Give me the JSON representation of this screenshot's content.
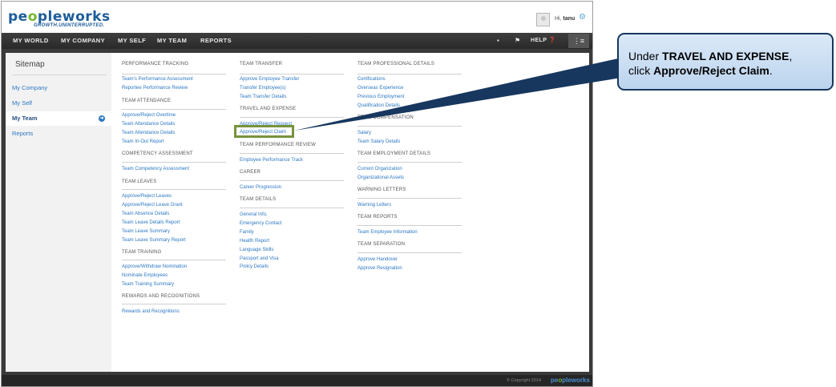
{
  "header": {
    "logo_pre": "pe",
    "logo_o": "o",
    "logo_post": "pleworks",
    "tagline": "GROWTH.UNINTERRUPTED.",
    "greeting_prefix": "Hi,",
    "user": "tanu"
  },
  "nav": {
    "items": [
      "MY WORLD",
      "MY COMPANY",
      "MY SELF",
      "MY TEAM",
      "REPORTS"
    ],
    "help_label": "HELP"
  },
  "sidebar": {
    "title": "Sitemap",
    "items": [
      "My Company",
      "My Self",
      "My Team",
      "Reports"
    ]
  },
  "columns": {
    "col1": {
      "performance_tracking": {
        "title": "PERFORMANCE TRACKING",
        "links": [
          "Team's Performance Assessment",
          "Reportee Performance Review"
        ]
      },
      "team_attendance": {
        "title": "TEAM ATTENDANCE",
        "links": [
          "Approve/Reject Overtime",
          "Team Attendance Details",
          "Team Attendance Details",
          "Team In-Out Report"
        ]
      },
      "competency_assessment": {
        "title": "COMPETENCY ASSESSMENT",
        "links": [
          "Team Competency Assessment"
        ]
      },
      "team_leaves": {
        "title": "TEAM LEAVES",
        "links": [
          "Approve/Reject Leaves",
          "Approve/Reject Leave Grant",
          "Team Absence Details",
          "Team Leave Details Report",
          "Team Leave Summary",
          "Team Leave Summary Report"
        ]
      },
      "team_training": {
        "title": "TEAM TRAINING",
        "links": [
          "Approve/Withdraw Nomination",
          "Nominate Employees",
          "Team Training Summary"
        ]
      },
      "rewards": {
        "title": "REWARDS AND RECOGNITIONS",
        "links": [
          "Rewards and Recognitions"
        ]
      }
    },
    "col2": {
      "team_transfer": {
        "title": "TEAM TRANSFER",
        "links": [
          "Approve Employee Transfer",
          "Transfer Employee(s)",
          "Team Transfer Details"
        ]
      },
      "travel_expense": {
        "title": "TRAVEL AND EXPENSE",
        "links": [
          "Approve/Reject Request",
          "Approve/Reject Claim"
        ]
      },
      "team_performance_review": {
        "title": "TEAM PERFORMANCE REVIEW",
        "links": [
          "Employee Performance Track"
        ]
      },
      "career": {
        "title": "CAREER",
        "links": [
          "Career Progression"
        ]
      },
      "team_details": {
        "title": "TEAM DETAILS",
        "links": [
          "General Info.",
          "Emergency Contact",
          "Family",
          "Health Report",
          "Language Skills",
          "Passport and Visa",
          "Policy Details"
        ]
      }
    },
    "col3": {
      "team_professional": {
        "title": "TEAM PROFESSIONAL DETAILS",
        "links": [
          "Certifications",
          "Overseas Experience",
          "Previous Employment",
          "Qualification Details"
        ]
      },
      "team_compensation": {
        "title": "TEAM COMPENSATION",
        "links": [
          "Salary",
          "Team Salary Details"
        ]
      },
      "team_employment": {
        "title": "TEAM EMPLOYMENT DETAILS",
        "links": [
          "Current Organization",
          "Organizational Assets"
        ]
      },
      "warning_letters": {
        "title": "WARNING LETTERS",
        "links": [
          "Warning Letters"
        ]
      },
      "team_reports": {
        "title": "TEAM REPORTS",
        "links": [
          "Team Employee Information"
        ]
      },
      "team_separation": {
        "title": "TEAM SEPARATION",
        "links": [
          "Approve Handover",
          "Approve Resignation"
        ]
      }
    }
  },
  "footer": {
    "copyright": "© Copyright 2014",
    "logo_pre": "pe",
    "logo_o": "o",
    "logo_post": "pleworks"
  },
  "callout": {
    "line1_prefix": "Under ",
    "line1_bold": "TRAVEL AND EXPENSE",
    "line1_suffix": ",",
    "line2_prefix": "click ",
    "line2_bold": "Approve/Reject Claim",
    "line2_suffix": "."
  },
  "colors": {
    "link": "#2d78c2",
    "highlight": "#77933c",
    "callout_border": "#17375e",
    "nav_bg": "#2a2a2a"
  },
  "icons": {
    "avatar": "user-avatar-icon",
    "settings": "gear-icon",
    "book": "book-icon",
    "flag": "flag-icon",
    "help": "help-icon",
    "menu": "menu-toggle-icon",
    "sidebar_arrow": "arrow-right-icon"
  }
}
